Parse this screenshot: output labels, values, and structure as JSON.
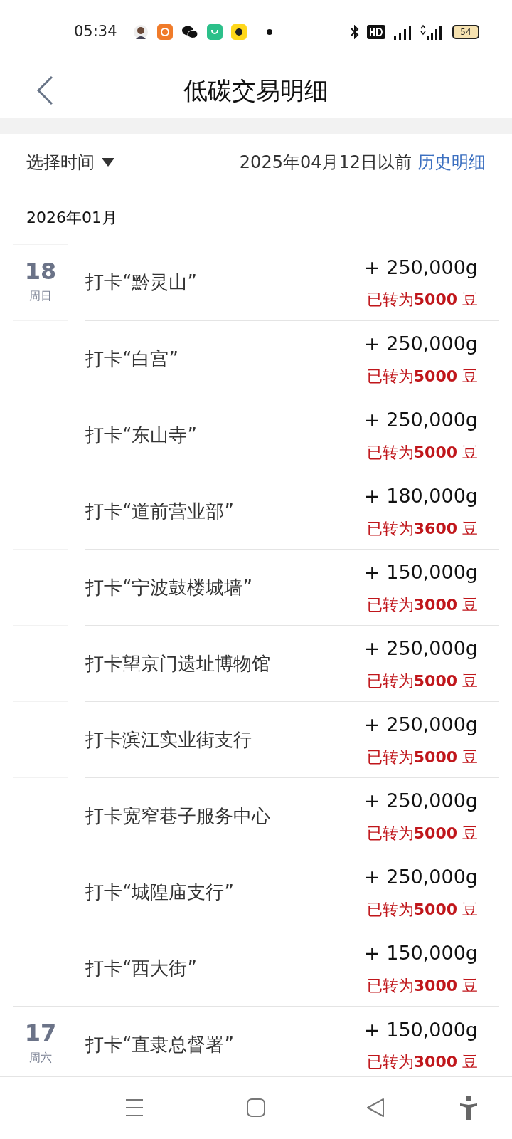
{
  "status_bar": {
    "time": "05:34",
    "battery": "54"
  },
  "header": {
    "title": "低碳交易明细"
  },
  "filter": {
    "select_label": "选择时间",
    "note": "2025年04月12日以前",
    "link": "历史明细"
  },
  "month": "2026年01月",
  "days": [
    {
      "day": "18",
      "weekday": "周日",
      "records": [
        {
          "title": "打卡“黔灵山”",
          "amount": "+ 250,000g",
          "converted": "已转为**5000** 豆"
        },
        {
          "title": "打卡“白宫”",
          "amount": "+ 250,000g",
          "converted": "已转为**5000** 豆"
        },
        {
          "title": "打卡“东山寺”",
          "amount": "+ 250,000g",
          "converted": "已转为**5000** 豆"
        },
        {
          "title": "打卡“道前营业部”",
          "amount": "+ 180,000g",
          "converted": "已转为**3600** 豆"
        },
        {
          "title": "打卡“宁波鼓楼城墙”",
          "amount": "+ 150,000g",
          "converted": "已转为**3000** 豆"
        },
        {
          "title": "打卡望京门遗址博物馆",
          "amount": "+ 250,000g",
          "converted": "已转为**5000** 豆"
        },
        {
          "title": "打卡滨江实业街支行",
          "amount": "+ 250,000g",
          "converted": "已转为**5000** 豆"
        },
        {
          "title": "打卡宽窄巷子服务中心",
          "amount": "+ 250,000g",
          "converted": "已转为**5000** 豆"
        },
        {
          "title": "打卡“城隍庙支行”",
          "amount": "+ 250,000g",
          "converted": "已转为**5000** 豆"
        },
        {
          "title": "打卡“西大街”",
          "amount": "+ 150,000g",
          "converted": "已转为**3000** 豆"
        }
      ]
    },
    {
      "day": "17",
      "weekday": "周六",
      "records": [
        {
          "title": "打卡“直隶总督署”",
          "amount": "+ 150,000g",
          "converted": "已转为**3000** 豆"
        }
      ]
    }
  ]
}
